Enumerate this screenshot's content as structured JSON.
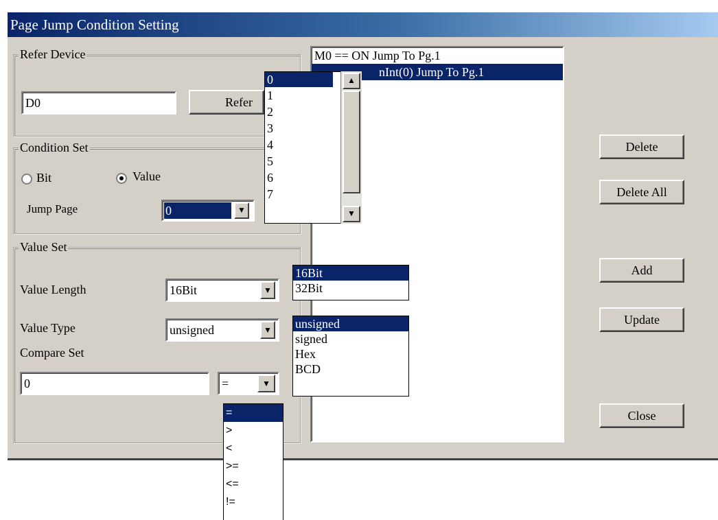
{
  "window": {
    "title": "Page Jump Condition Setting"
  },
  "refer_device": {
    "group_title": "Refer Device",
    "value": "D0",
    "refer_button": "Refer"
  },
  "condition_set": {
    "group_title": "Condition Set",
    "radio_bit": "Bit",
    "radio_value": "Value",
    "selected_mode": "Value",
    "jump_page_label": "Jump Page",
    "jump_page_value": "0",
    "jump_page_options": [
      "0",
      "1",
      "2",
      "3",
      "4",
      "5",
      "6",
      "7"
    ]
  },
  "value_set": {
    "group_title": "Value Set",
    "length_label": "Value Length",
    "length_value": "16Bit",
    "length_options": [
      "16Bit",
      "32Bit"
    ],
    "type_label": "Value Type",
    "type_value": "unsigned",
    "type_options": [
      "unsigned",
      "signed",
      "Hex",
      "BCD"
    ],
    "compare_label": "Compare Set",
    "compare_value": "0",
    "operator_value": "=",
    "operator_options": [
      "=",
      ">",
      "<",
      ">=",
      "<=",
      "!="
    ]
  },
  "condition_list": {
    "items": [
      "M0 == ON Jump To Pg.1",
      "nInt(0) Jump To Pg.1"
    ],
    "selected_index": 1
  },
  "buttons": {
    "delete": "Delete",
    "delete_all": "Delete All",
    "add": "Add",
    "update": "Update",
    "close": "Close"
  },
  "colors": {
    "selection": "#0a246a",
    "dialog_bg": "#d4d0c8"
  }
}
